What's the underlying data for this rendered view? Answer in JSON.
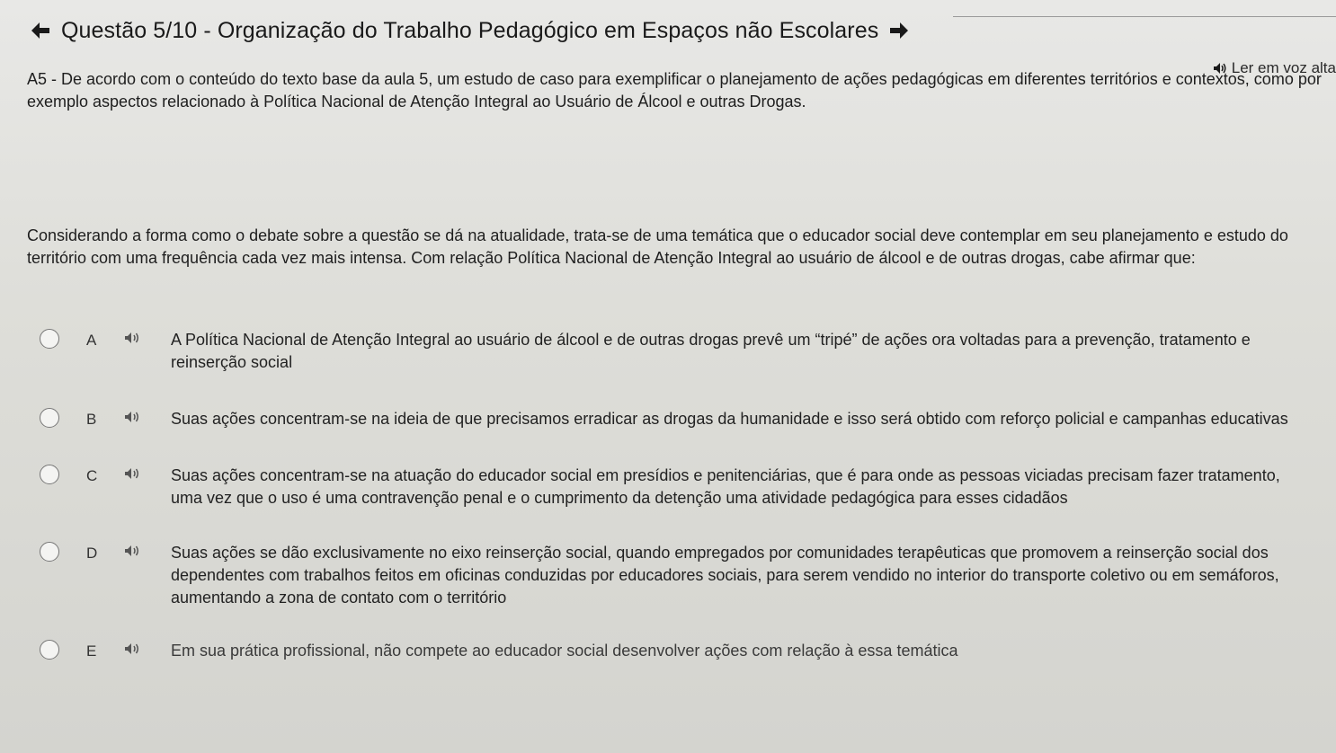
{
  "header": {
    "title": "Questão 5/10 - Organização do Trabalho Pedagógico em Espaços não Escolares"
  },
  "read_aloud_label": "Ler em voz alta",
  "intro_text": "A5 - De acordo com o conteúdo do texto base da aula 5, um estudo de caso para exemplificar o planejamento de ações pedagógicas em diferentes territórios e contextos, como por exemplo aspectos relacionado à Política Nacional de Atenção Integral ao Usuário de Álcool e outras Drogas.",
  "stem_text": "Considerando a forma como o debate sobre a questão se dá na atualidade, trata-se de uma temática que o educador social deve contemplar em seu planejamento e estudo do território com uma frequência cada vez mais intensa. Com relação Política Nacional de Atenção Integral ao usuário de álcool e de outras drogas, cabe afirmar que:",
  "options": [
    {
      "letter": "A",
      "text": "A Política Nacional de Atenção Integral ao usuário de álcool e de outras drogas prevê um “tripé” de ações ora voltadas para a prevenção, tratamento e reinserção social"
    },
    {
      "letter": "B",
      "text": "Suas ações concentram-se na ideia de que precisamos erradicar as drogas da humanidade e isso será obtido com reforço policial e campanhas educativas"
    },
    {
      "letter": "C",
      "text": "Suas ações concentram-se na atuação do educador social em presídios e penitenciárias, que é para onde as pessoas viciadas precisam fazer tratamento, uma vez que o uso é uma contravenção penal e o cumprimento da detenção uma atividade pedagógica para esses cidadãos"
    },
    {
      "letter": "D",
      "text": "Suas ações se dão exclusivamente no eixo reinserção social, quando empregados por comunidades terapêuticas que promovem a reinserção social dos dependentes com trabalhos feitos em oficinas conduzidas por educadores sociais, para serem vendido no interior do transporte coletivo ou em semáforos, aumentando a zona de contato com o território"
    },
    {
      "letter": "E",
      "text": "Em sua prática profissional, não compete ao educador social desenvolver ações com relação à essa temática"
    }
  ]
}
